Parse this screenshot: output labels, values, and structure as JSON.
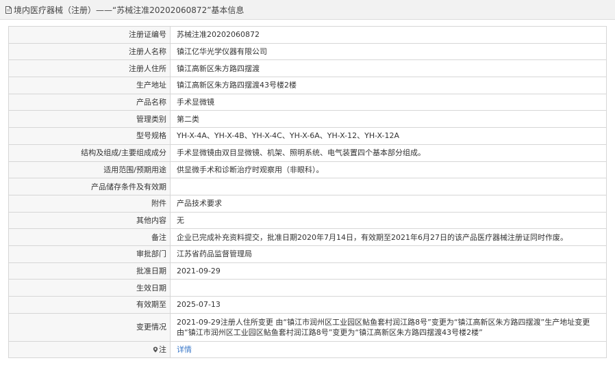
{
  "header": {
    "title": "境内医疗器械（注册）——“苏械注准20202060872”基本信息",
    "icon": "document-icon"
  },
  "rows": [
    {
      "label": "注册证编号",
      "value": "苏械注准20202060872"
    },
    {
      "label": "注册人名称",
      "value": "镇江亿华光学仪器有限公司"
    },
    {
      "label": "注册人住所",
      "value": "镇江高新区朱方路四摆渡"
    },
    {
      "label": "生产地址",
      "value": "镇江高新区朱方路四摆渡43号楼2楼"
    },
    {
      "label": "产品名称",
      "value": "手术显微镜"
    },
    {
      "label": "管理类别",
      "value": "第二类"
    },
    {
      "label": "型号规格",
      "value": "YH-X-4A、YH-X-4B、YH-X-4C、YH-X-6A、YH-X-12、YH-X-12A"
    },
    {
      "label": "结构及组成/主要组成成分",
      "value": "手术显微镜由双目显微镜、机架、照明系统、电气装置四个基本部分组成。"
    },
    {
      "label": "适用范围/预期用途",
      "value": "供显微手术和诊断治疗时观察用（非眼科）。"
    },
    {
      "label": "产品储存条件及有效期",
      "value": ""
    },
    {
      "label": "附件",
      "value": "产品技术要求"
    },
    {
      "label": "其他内容",
      "value": "无"
    },
    {
      "label": "备注",
      "value": "企业已完成补充资料提交，批准日期2020年7月14日，有效期至2021年6月27日的该产品医疗器械注册证同时作废。"
    },
    {
      "label": "审批部门",
      "value": "江苏省药品监督管理局"
    },
    {
      "label": "批准日期",
      "value": "2021-09-29"
    },
    {
      "label": "生效日期",
      "value": ""
    },
    {
      "label": "有效期至",
      "value": "2025-07-13"
    }
  ],
  "change": {
    "label": "变更情况",
    "value": "2021-09-29注册人住所变更 由“镇江市润州区工业园区鲇鱼套村润江路8号”变更为“镇江高新区朱方路四摆渡”生产地址变更 由“镇江市润州区工业园区鲇鱼套村润江路8号”变更为“镇江高新区朱方路四摆渡43号楼2楼”"
  },
  "note": {
    "label": "注",
    "icon": "location-pin-icon",
    "link_text": "详情",
    "link_color": "#3a78c9"
  }
}
